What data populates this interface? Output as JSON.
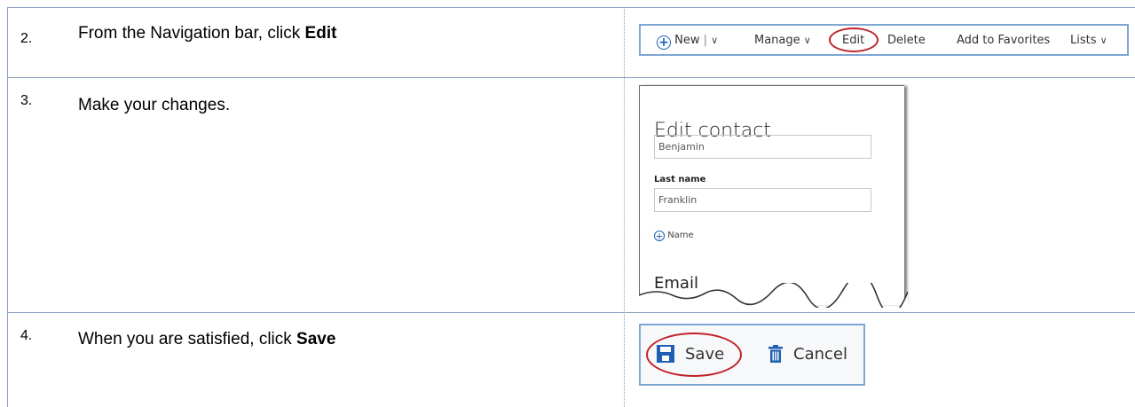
{
  "steps": [
    {
      "number": "2.",
      "text_before": "From the Navigation bar, click ",
      "text_bold": "Edit"
    },
    {
      "number": "3.",
      "text_before": "Make your changes.",
      "text_bold": ""
    },
    {
      "number": "4.",
      "text_before": "When you are satisfied, click ",
      "text_bold": "Save"
    }
  ],
  "navbar": {
    "new_label": "New",
    "manage_label": "Manage",
    "edit_label": "Edit",
    "delete_label": "Delete",
    "favorites_label": "Add to Favorites",
    "lists_label": "Lists"
  },
  "contact_form": {
    "title": "Edit contact",
    "first_name_value": "Benjamin",
    "last_name_label": "Last name",
    "last_name_value": "Franklin",
    "add_name_label": "Name",
    "email_label": "Email"
  },
  "savebar": {
    "save_label": "Save",
    "cancel_label": "Cancel"
  },
  "colors": {
    "highlight_ring": "#c0232a",
    "accent_blue": "#1e5fb4",
    "border_blue": "#7ea7d4"
  },
  "icons": [
    "plus-circle-icon",
    "chevron-down-icon",
    "save-icon",
    "trash-icon"
  ]
}
